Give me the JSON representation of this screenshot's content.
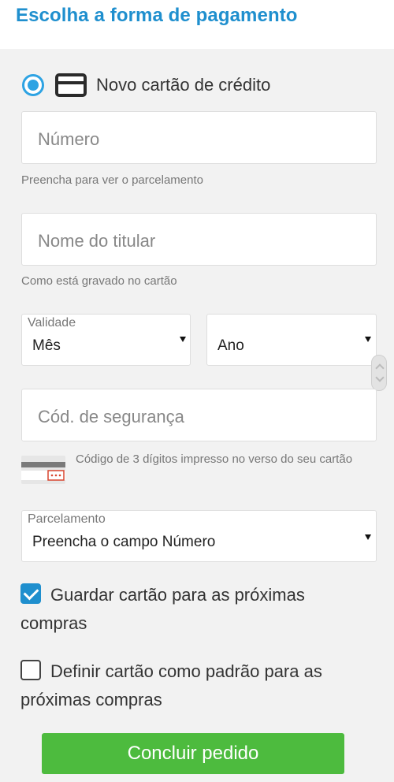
{
  "header": {
    "title": "Escolha a forma de pagamento"
  },
  "payment_option": {
    "label": "Novo cartão de crédito",
    "selected": true
  },
  "number_field": {
    "placeholder": "Número",
    "hint": "Preencha para ver o parcelamento"
  },
  "holder_field": {
    "placeholder": "Nome do titular",
    "hint": "Como está gravado no cartão"
  },
  "validity": {
    "label": "Validade",
    "month_value": "Mês",
    "year_value": "Ano"
  },
  "security_field": {
    "placeholder": "Cód. de segurança",
    "hint": "Código de 3 dígitos impresso no verso do seu cartão"
  },
  "installments": {
    "label": "Parcelamento",
    "value": "Preencha o campo Número"
  },
  "save_card": {
    "label": "Guardar cartão para as próximas compras",
    "checked": true
  },
  "default_card": {
    "label": "Definir cartão como padrão para as próximas compras",
    "checked": false
  },
  "submit": {
    "label": "Concluir pedido"
  },
  "colors": {
    "accent": "#1f8fce",
    "button": "#4dbb3e",
    "panel": "#f2f2f2"
  }
}
